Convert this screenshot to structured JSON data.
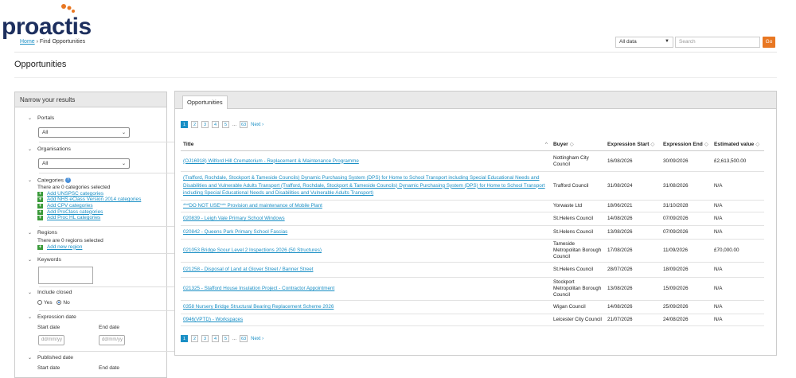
{
  "logo": {
    "text": "proactis"
  },
  "breadcrumb": {
    "home": "Home",
    "separator": " › ",
    "current": "Find Opportunities"
  },
  "search": {
    "scope": "All data",
    "placeholder": "Search",
    "go_label": "Go"
  },
  "page_title": "Opportunities",
  "filters": {
    "header": "Narrow your results",
    "portals": {
      "title": "Portals",
      "value": "All"
    },
    "organisations": {
      "title": "Organisations",
      "value": "All"
    },
    "categories": {
      "title": "Categories",
      "selected_text": "There are 0 categories selected",
      "links": [
        "Add UNSPSC categories",
        "Add NHS eClass Version 2014 categories",
        "Add CPV categories",
        "Add ProClass categories",
        "Add Proc HL categories"
      ]
    },
    "regions": {
      "title": "Regions",
      "selected_text": "There are 0 regions selected",
      "add_link": "Add new region"
    },
    "keywords": {
      "title": "Keywords"
    },
    "include_closed": {
      "title": "Include closed",
      "yes": "Yes",
      "no": "No",
      "selected": "No"
    },
    "expression_date": {
      "title": "Expression date",
      "start_label": "Start date",
      "end_label": "End date",
      "placeholder": "dd/mm/yy"
    },
    "published_date": {
      "title": "Published date",
      "start_label": "Start date",
      "end_label": "End date"
    }
  },
  "results": {
    "tab": "Opportunities",
    "pager": {
      "pages": [
        "1",
        "2",
        "3",
        "4",
        "5"
      ],
      "dots": "...",
      "last": "63",
      "next": "Next ›",
      "current": "1"
    },
    "columns": {
      "title": "Title",
      "buyer": "Buyer",
      "expression_start": "Expression Start",
      "expression_end": "Expression End",
      "estimated_value": "Estimated value"
    },
    "rows": [
      {
        "title": "(OJ16918) Wilford Hill Crematorium - Replacement & Maintenance Programme",
        "buyer": "Nottingham City Council",
        "start": "16/08/2026",
        "end": "30/09/2026",
        "value": "£2,613,500.00"
      },
      {
        "title": "(Trafford, Rochdale, Stockport & Tameside Councils) Dynamic Purchasing System (DPS) for Home to School Transport including Special Educational Needs and Disabilities and Vulnerable Adults Transport (Trafford, Rochdale, Stockport & Tameside Councils) Dynamic Purchasing System (DPS) for Home to School Transport including Special Educational Needs and Disabilities and Vulnerable Adults Transport)",
        "buyer": "Trafford Council",
        "start": "31/08/2024",
        "end": "31/08/2026",
        "value": "N/A"
      },
      {
        "title": "***DO NOT USE*** Provision and maintenance of Mobile Plant",
        "buyer": "Yorwaste Ltd",
        "start": "18/06/2021",
        "end": "31/10/2028",
        "value": "N/A"
      },
      {
        "title": "020839 - Leigh Vale Primary School Windows",
        "buyer": "St.Helens Council",
        "start": "14/08/2026",
        "end": "07/09/2026",
        "value": "N/A"
      },
      {
        "title": "020842 - Queens Park Primary School Fascias",
        "buyer": "St.Helens Council",
        "start": "13/08/2026",
        "end": "07/09/2026",
        "value": "N/A"
      },
      {
        "title": "021053 Bridge Scour Level 2 Inspections 2026 (50 Structures)",
        "buyer": "Tameside Metropolitan Borough Council",
        "start": "17/08/2026",
        "end": "11/09/2026",
        "value": "£70,000.00"
      },
      {
        "title": "021258 - Disposal of Land at Glover Street / Banner Street",
        "buyer": "St.Helens Council",
        "start": "28/07/2026",
        "end": "18/09/2026",
        "value": "N/A"
      },
      {
        "title": "021325 - Stafford House Insulation Project - Contractor Appointment",
        "buyer": "Stockport Metropolitan Borough Council",
        "start": "13/08/2026",
        "end": "15/09/2026",
        "value": "N/A"
      },
      {
        "title": "0358 Nursery Bridge Structural Bearing Replacement Scheme 2026",
        "buyer": "Wigan Council",
        "start": "14/08/2026",
        "end": "25/09/2026",
        "value": "N/A"
      },
      {
        "title": "0946(VPTD) - Workspaces",
        "buyer": "Leicester City Council",
        "start": "21/07/2026",
        "end": "24/08/2026",
        "value": "N/A"
      }
    ]
  },
  "colors": {
    "brand_navy": "#1d2f5e",
    "brand_orange": "#e87722",
    "link": "#1a8fc5",
    "add_green": "#3a9a3a"
  }
}
